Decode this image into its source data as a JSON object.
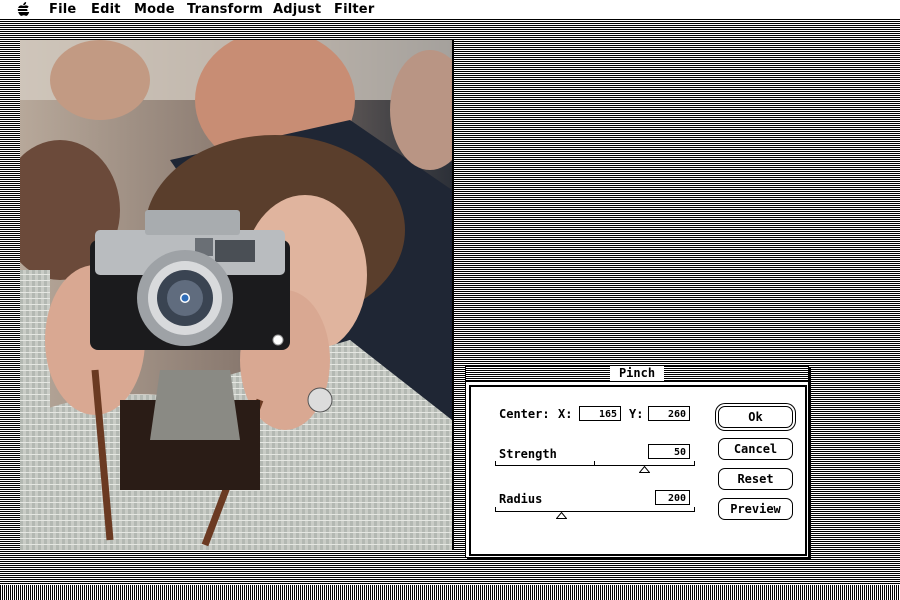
{
  "menubar": {
    "apple_icon": "apple-logo-icon",
    "items": [
      {
        "label": "File"
      },
      {
        "label": "Edit"
      },
      {
        "label": "Mode"
      },
      {
        "label": "Transform"
      },
      {
        "label": "Adjust"
      },
      {
        "label": "Filter"
      }
    ]
  },
  "canvas": {
    "pinch_center_marker_icon": "pinch-center-marker-icon"
  },
  "dialog": {
    "title": "Pinch",
    "center_label": "Center:",
    "x_label": "X:",
    "x_value": "165",
    "y_label": "Y:",
    "y_value": "260",
    "strength_label": "Strength",
    "strength_value": "50",
    "strength_fraction": 0.75,
    "radius_label": "Radius",
    "radius_value": "200",
    "radius_fraction": 0.33,
    "buttons": {
      "ok": "Ok",
      "cancel": "Cancel",
      "reset": "Reset",
      "preview": "Preview"
    }
  },
  "colors": {
    "marker_fill": "#2f6db8",
    "desktop_pattern": "#000000"
  }
}
